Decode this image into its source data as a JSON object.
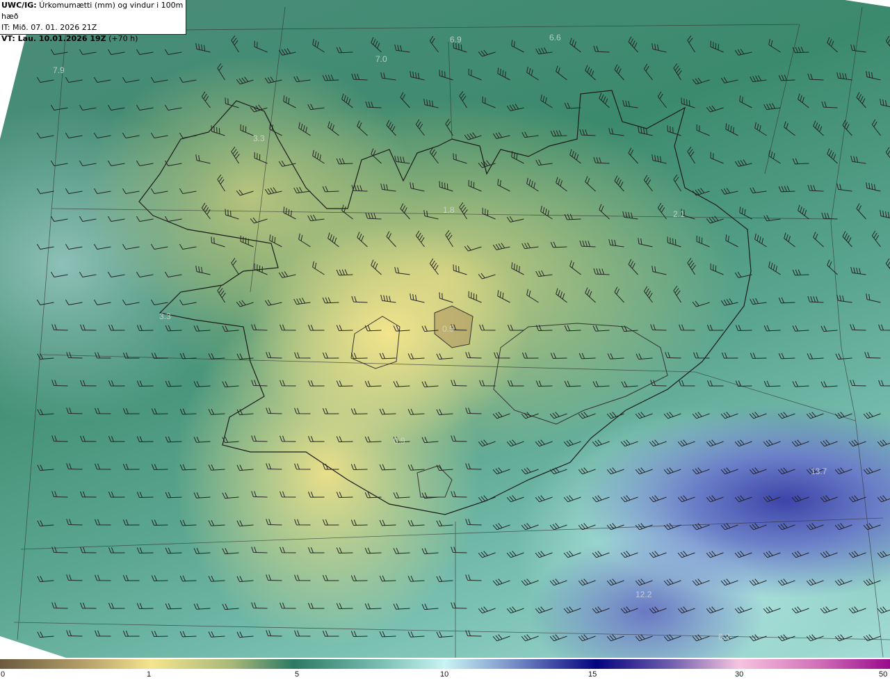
{
  "header": {
    "model": "UWC/IG:",
    "title": "Úrkomumætti (mm) og vindur i 100m hæð",
    "initial_time": "IT: Mið. 07. 01. 2026 21Z",
    "valid_label": "VT: Lau. 10.01.2026 19Z",
    "lead": "(+70 h)"
  },
  "map_values": [
    "7.9",
    "7.0",
    "6.9",
    "6.6",
    "3.3",
    "1.8",
    "2.1",
    "3.3",
    "0.5",
    "0.9",
    "13.7",
    "12.2",
    "6.2"
  ],
  "colorbar": {
    "unit": "mm",
    "ticks": [
      "0",
      "1",
      "5",
      "10",
      "15",
      "30",
      "50"
    ],
    "colors": [
      "#6b5a3e",
      "#f4e58e",
      "#2c7a64",
      "#c8f4f4",
      "#040480",
      "#f6c4e0",
      "#9a0a8c"
    ]
  }
}
